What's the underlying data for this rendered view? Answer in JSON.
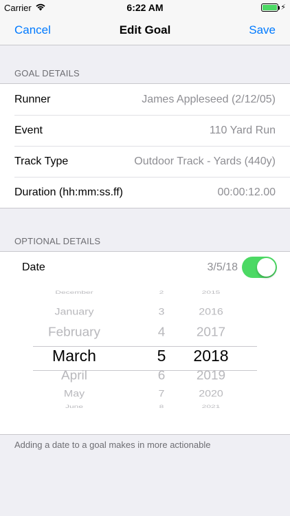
{
  "status_bar": {
    "carrier": "Carrier",
    "time": "6:22 AM",
    "battery_color": "#4cd964"
  },
  "nav": {
    "cancel_label": "Cancel",
    "title": "Edit Goal",
    "save_label": "Save",
    "tint_color": "#007aff"
  },
  "goal_details": {
    "header": "GOAL DETAILS",
    "rows": [
      {
        "label": "Runner",
        "value": "James Appleseed (2/12/05)"
      },
      {
        "label": "Event",
        "value": "110 Yard Run"
      },
      {
        "label": "Track Type",
        "value": "Outdoor Track - Yards (440y)"
      },
      {
        "label": "Duration (hh:mm:ss.ff)",
        "value": "00:00:12.00"
      }
    ]
  },
  "optional_details": {
    "header": "OPTIONAL DETAILS",
    "date_label": "Date",
    "date_value": "3/5/18",
    "date_toggle_on": true,
    "toggle_color": "#4cd964"
  },
  "date_picker": {
    "months": [
      "December",
      "January",
      "February",
      "March",
      "April",
      "May",
      "June"
    ],
    "days": [
      "2",
      "3",
      "4",
      "5",
      "6",
      "7",
      "8"
    ],
    "years": [
      "2015",
      "2016",
      "2017",
      "2018",
      "2019",
      "2020",
      "2021"
    ],
    "selected_month": "March",
    "selected_day": "5",
    "selected_year": "2018"
  },
  "footer_note": "Adding a date to a goal makes in more actionable"
}
